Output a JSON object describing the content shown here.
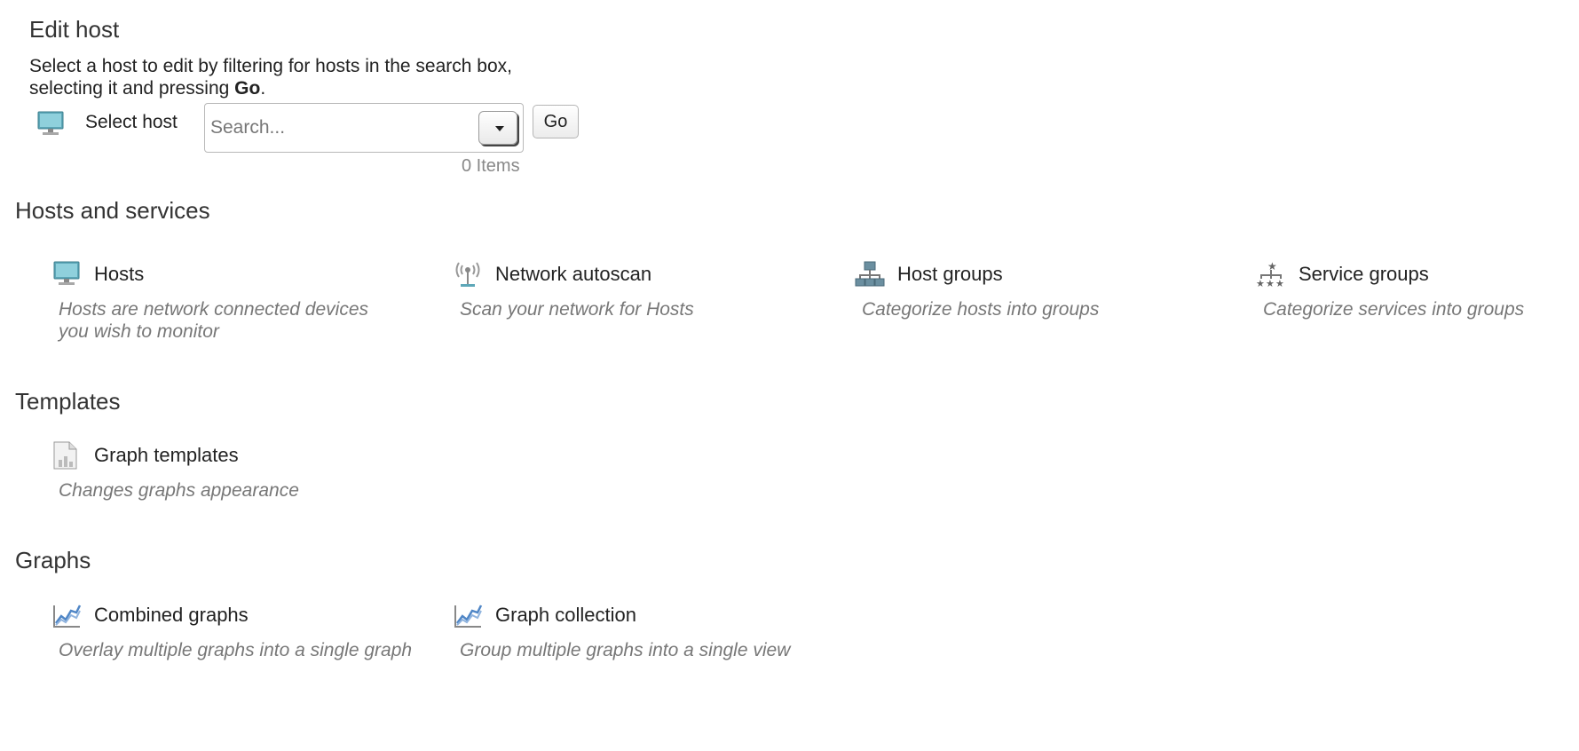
{
  "edit_host": {
    "title": "Edit host",
    "desc_part1": "Select a host to edit by filtering for hosts in the search box,",
    "desc_part2": "selecting it and pressing ",
    "desc_bold": "Go",
    "desc_end": ".",
    "select_label": "Select host",
    "search_placeholder": "Search...",
    "go_label": "Go",
    "items_count": "0 Items"
  },
  "sections": {
    "hosts_services": {
      "heading": "Hosts and services",
      "items": [
        {
          "name": "Hosts",
          "desc": "Hosts are network connected devices you wish to monitor",
          "icon": "host-icon"
        },
        {
          "name": "Network autoscan",
          "desc": "Scan your network for Hosts",
          "icon": "antenna-icon"
        },
        {
          "name": "Host groups",
          "desc": "Categorize hosts into groups",
          "icon": "host-groups-icon"
        },
        {
          "name": "Service groups",
          "desc": "Categorize services into groups",
          "icon": "service-groups-icon"
        }
      ]
    },
    "templates": {
      "heading": "Templates",
      "items": [
        {
          "name": "Graph templates",
          "desc": "Changes graphs appearance",
          "icon": "graph-template-icon"
        }
      ]
    },
    "graphs": {
      "heading": "Graphs",
      "items": [
        {
          "name": "Combined graphs",
          "desc": "Overlay multiple graphs into a single graph",
          "icon": "chart-icon"
        },
        {
          "name": "Graph collection",
          "desc": "Group multiple graphs into a single view",
          "icon": "chart-icon"
        }
      ]
    }
  }
}
